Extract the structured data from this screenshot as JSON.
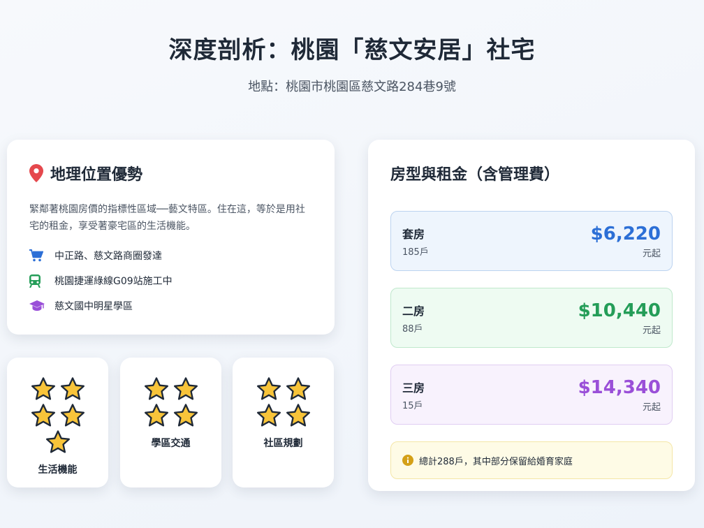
{
  "header": {
    "title": "深度剖析：桃園「慈文安居」社宅",
    "subtitle": "地點：桃園市桃園區慈文路284巷9號"
  },
  "location": {
    "heading": "地理位置優勢",
    "icon": "map-pin-icon",
    "description": "緊鄰著桃園房價的指標性區域──藝文特區。住在這，等於是用社宅的租金，享受著豪宅區的生活機能。",
    "features": [
      {
        "icon": "shopping-cart-icon",
        "color": "#2c6fd6",
        "label": "中正路、慈文路商圈發達"
      },
      {
        "icon": "train-icon",
        "color": "#249d58",
        "label": "桃園捷運綠線G09站施工中"
      },
      {
        "icon": "graduation-cap-icon",
        "color": "#9a4fd8",
        "label": "慈文國中明星學區"
      }
    ]
  },
  "ratings": [
    {
      "label": "生活機能",
      "stars": 5
    },
    {
      "label": "學區交通",
      "stars": 4
    },
    {
      "label": "社區規劃",
      "stars": 4
    }
  ],
  "rent": {
    "heading": "房型與租金（含管理費）",
    "units": [
      {
        "name": "套房",
        "count": "185戶",
        "price": "$6,220",
        "price_unit": "元起",
        "color": "#2c6fd6"
      },
      {
        "name": "二房",
        "count": "88戶",
        "price": "$10,440",
        "price_unit": "元起",
        "color": "#249d58"
      },
      {
        "name": "三房",
        "count": "15戶",
        "price": "$14,340",
        "price_unit": "元起",
        "color": "#9a4fd8"
      }
    ],
    "note": "總計288戶，其中部分保留給婚育家庭",
    "note_icon": "info-icon"
  },
  "colors": {
    "star_fill": "#f8c43a",
    "star_stroke": "#1f2937",
    "pin": "#e5484d",
    "info": "#d4a017"
  }
}
